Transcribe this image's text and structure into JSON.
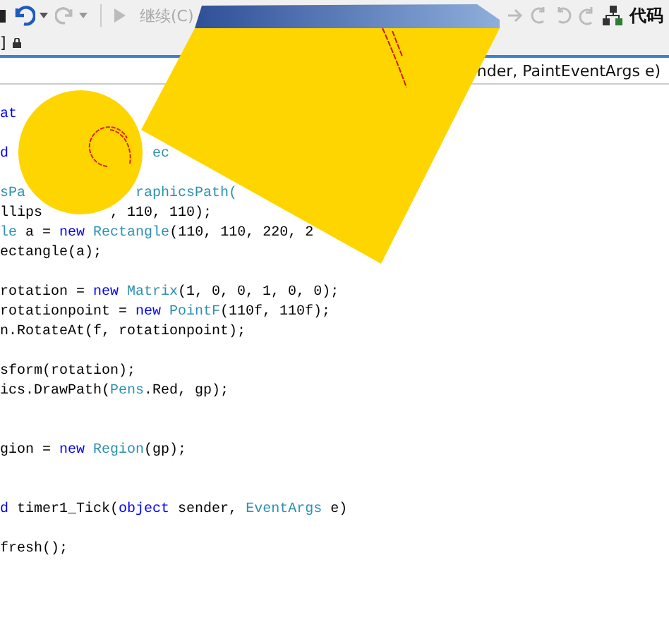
{
  "toolbar": {
    "run_label": "继续(C)",
    "right_label": "代码"
  },
  "document_tab": {
    "label": "]"
  },
  "nav_bar": {
    "text": "nder, PaintEventArgs e)"
  },
  "code_lines": [
    {
      "segments": [
        [
          {
            "text": "at",
            "kind": "keyword"
          }
        ]
      ]
    },
    {
      "segments": [
        [
          {
            "text": "d",
            "kind": "keyword"
          }
        ],
        [
          {
            "text": "ec",
            "kind": "type"
          }
        ]
      ]
    },
    {
      "segments": [
        [
          {
            "text": "sPa",
            "kind": "type"
          }
        ],
        [
          {
            "text": "raphicsPath(",
            "kind": "type"
          }
        ]
      ]
    },
    {
      "segments": [
        [
          {
            "text": "llips",
            "kind": "plain"
          }
        ],
        [
          {
            "text": ", 110, 110);",
            "kind": "plain"
          }
        ]
      ]
    },
    {
      "segments": [
        [
          {
            "text": "le",
            "kind": "type"
          },
          {
            "text": " a = ",
            "kind": "plain"
          },
          {
            "text": "new ",
            "kind": "keyword"
          },
          {
            "text": "Rectangle",
            "kind": "type"
          },
          {
            "text": "(110, 110, 220, 2",
            "kind": "plain"
          }
        ]
      ]
    },
    {
      "segments": [
        [
          {
            "text": "ectangle(a);",
            "kind": "plain"
          }
        ]
      ]
    },
    {
      "segments": [
        [
          {
            "text": "rotation = ",
            "kind": "plain"
          },
          {
            "text": "new ",
            "kind": "keyword"
          },
          {
            "text": "Matrix",
            "kind": "type"
          },
          {
            "text": "(1, 0, 0, 1, 0, 0);",
            "kind": "plain"
          }
        ]
      ]
    },
    {
      "segments": [
        [
          {
            "text": "rotationpoint = ",
            "kind": "plain"
          },
          {
            "text": "new ",
            "kind": "keyword"
          },
          {
            "text": "PointF",
            "kind": "type"
          },
          {
            "text": "(110f, 110f);",
            "kind": "plain"
          }
        ]
      ]
    },
    {
      "segments": [
        [
          {
            "text": "n.RotateAt(f, rotationpoint);",
            "kind": "plain"
          }
        ]
      ]
    },
    {
      "segments": [
        [
          {
            "text": "sform(rotation);",
            "kind": "plain"
          }
        ]
      ]
    },
    {
      "segments": [
        [
          {
            "text": "ics.DrawPath(",
            "kind": "plain"
          },
          {
            "text": "Pens",
            "kind": "type"
          },
          {
            "text": ".Red, gp);",
            "kind": "plain"
          }
        ]
      ]
    },
    {
      "segments": [
        [
          {
            "text": "gion = ",
            "kind": "plain"
          },
          {
            "text": "new ",
            "kind": "keyword"
          },
          {
            "text": "Region",
            "kind": "type"
          },
          {
            "text": "(gp);",
            "kind": "plain"
          }
        ]
      ]
    },
    {
      "segments": [
        [
          {
            "text": "d",
            "kind": "keyword"
          },
          {
            "text": " timer1_Tick(",
            "kind": "plain"
          },
          {
            "text": "object",
            "kind": "keyword"
          },
          {
            "text": " sender, ",
            "kind": "plain"
          },
          {
            "text": "EventArgs",
            "kind": "type"
          },
          {
            "text": " e)",
            "kind": "plain"
          }
        ]
      ]
    },
    {
      "segments": [
        [
          {
            "text": "fresh();",
            "kind": "plain"
          }
        ]
      ]
    }
  ]
}
